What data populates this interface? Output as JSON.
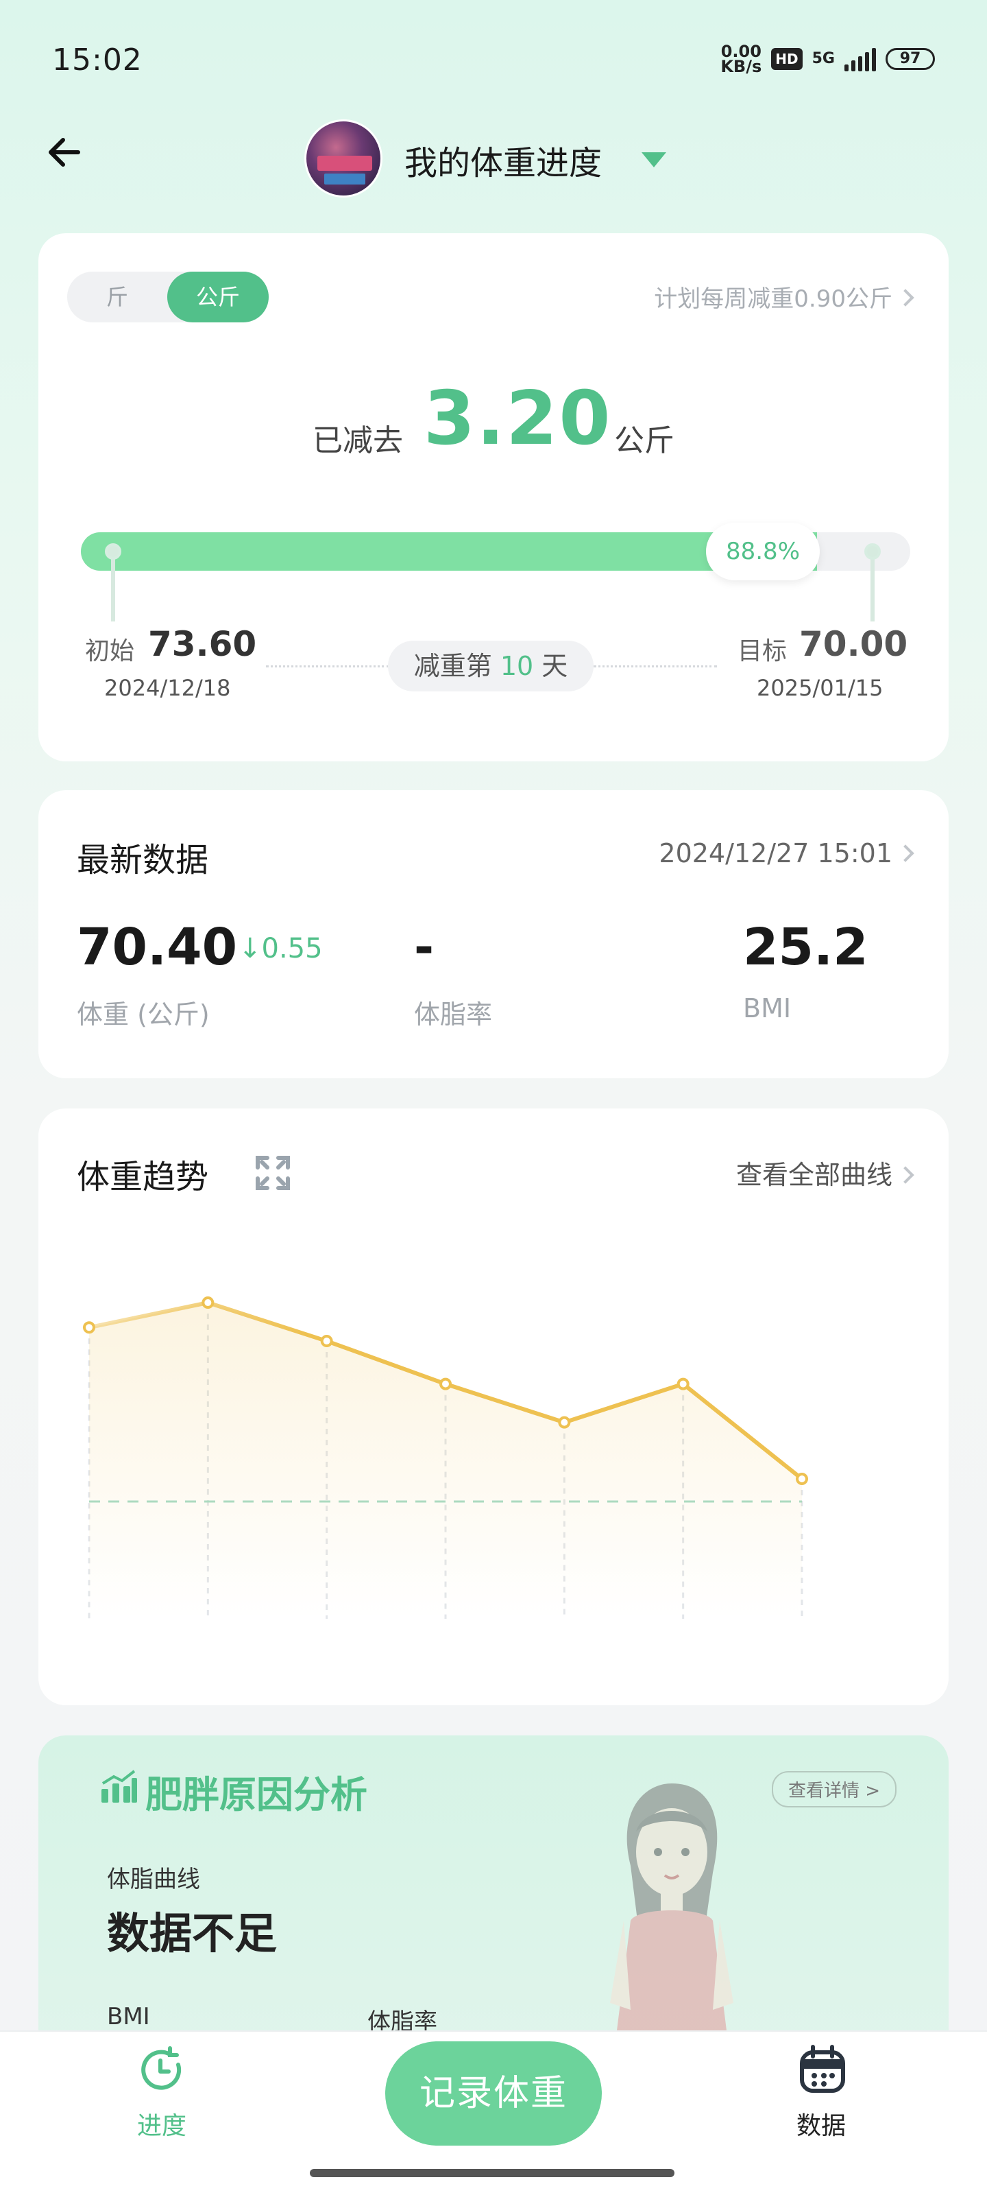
{
  "status_bar": {
    "time": "15:02",
    "net_speed_top": "0.00",
    "net_speed_bottom": "KB/s",
    "hd": "HD",
    "network": "5G",
    "battery": "97"
  },
  "header": {
    "title": "我的体重进度"
  },
  "progress_card": {
    "unit_jin": "斤",
    "unit_kg": "公斤",
    "plan_text": "计划每周减重0.90公斤",
    "lost_label": "已减去",
    "lost_value": "3.20",
    "lost_unit": "公斤",
    "progress_text": "88.8%",
    "progress_fraction": 0.888,
    "start_label": "初始",
    "start_value": "73.60",
    "start_date": "2024/12/18",
    "target_label": "目标",
    "target_value": "70.00",
    "target_date": "2025/01/15",
    "day_prefix": "减重第 ",
    "day_number": "10",
    "day_suffix": " 天"
  },
  "latest": {
    "title": "最新数据",
    "timestamp": "2024/12/27 15:01",
    "weight_value": "70.40",
    "weight_delta": "↓0.55",
    "weight_label": "体重 (公斤)",
    "bodyfat_value": "-",
    "bodyfat_label": "体脂率",
    "bmi_value": "25.2",
    "bmi_label": "BMI"
  },
  "trend": {
    "title": "体重趋势",
    "link": "查看全部曲线"
  },
  "chart_data": {
    "type": "line",
    "x": [
      1,
      2,
      3,
      4,
      5,
      6,
      7
    ],
    "series": [
      {
        "values": [
          72.5,
          73.6,
          71.9,
          70.0,
          68.3,
          70.0,
          65.8
        ]
      }
    ],
    "reference_line": 64.8,
    "ylim": [
      59.0,
      76.0
    ],
    "color": "#eec151",
    "grid": false
  },
  "analysis": {
    "title": "肥胖原因分析",
    "link": "查看详情 >",
    "curve_label": "体脂曲线",
    "state": "数据不足",
    "bmi_label": "BMI",
    "bodyfat_label": "体脂率"
  },
  "bottom_nav": {
    "progress_label": "进度",
    "record_label": "记录体重",
    "data_label": "数据"
  },
  "colors": {
    "accent": "#52c08a",
    "progress_fill": "#7fe0a3",
    "chart_line": "#eec151"
  }
}
